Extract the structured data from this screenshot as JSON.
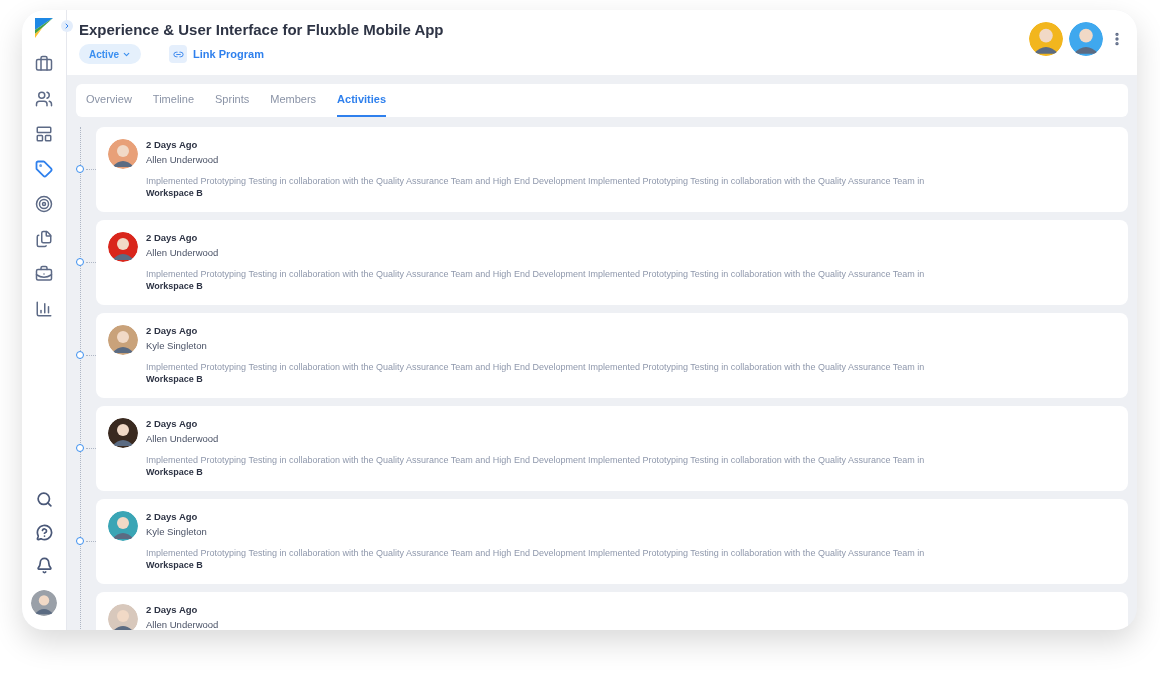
{
  "header": {
    "title": "Experience & User Interface for Fluxble Mobile App",
    "status": "Active",
    "link": "Link Program"
  },
  "sidebar": {
    "items": [
      {
        "kind": "briefcase",
        "selected": false
      },
      {
        "kind": "team",
        "selected": false
      },
      {
        "kind": "board",
        "selected": false
      },
      {
        "kind": "tag",
        "selected": true
      },
      {
        "kind": "target",
        "selected": false
      },
      {
        "kind": "docs",
        "selected": false
      },
      {
        "kind": "case",
        "selected": false
      },
      {
        "kind": "chart",
        "selected": false
      }
    ],
    "bottom": [
      {
        "kind": "search"
      },
      {
        "kind": "help"
      },
      {
        "kind": "bell"
      }
    ]
  },
  "tabs": [
    {
      "label": "Overview",
      "selected": false
    },
    {
      "label": "Timeline",
      "selected": false
    },
    {
      "label": "Sprints",
      "selected": false
    },
    {
      "label": "Members",
      "selected": false
    },
    {
      "label": "Activities",
      "selected": true
    }
  ],
  "activities": [
    {
      "time": "2 Days Ago",
      "name": "Allen Underwood",
      "text": "Implemented Prototyping Testing in collaboration with the Quality Assurance Team and High End Development Implemented Prototyping Testing in collaboration with the Quality Assurance Team in **Workspace B**",
      "color": "#e8a078"
    },
    {
      "time": "2 Days Ago",
      "name": "Allen Underwood",
      "text": "Implemented Prototyping Testing in collaboration with the Quality Assurance Team and High End Development Implemented Prototyping Testing in collaboration with the Quality Assurance Team in **Workspace B**",
      "color": "#d9261c"
    },
    {
      "time": "2 Days Ago",
      "name": "Kyle Singleton",
      "text": "Implemented Prototyping Testing in collaboration with the Quality Assurance Team and High End Development Implemented Prototyping Testing in collaboration with the Quality Assurance Team in **Workspace B**",
      "color": "#c9a27a"
    },
    {
      "time": "2 Days Ago",
      "name": "Allen Underwood",
      "text": "Implemented Prototyping Testing in collaboration with the Quality Assurance Team and High End Development Implemented Prototyping Testing in collaboration with the Quality Assurance Team in **Workspace B**",
      "color": "#3a2a20"
    },
    {
      "time": "2 Days Ago",
      "name": "Kyle Singleton",
      "text": "Implemented Prototyping Testing in collaboration with the Quality Assurance Team and High End Development Implemented Prototyping Testing in collaboration with the Quality Assurance Team in **Workspace B**",
      "color": "#3aa5b5"
    },
    {
      "time": "2 Days Ago",
      "name": "Allen Underwood",
      "color": "#d8c8bc"
    }
  ]
}
